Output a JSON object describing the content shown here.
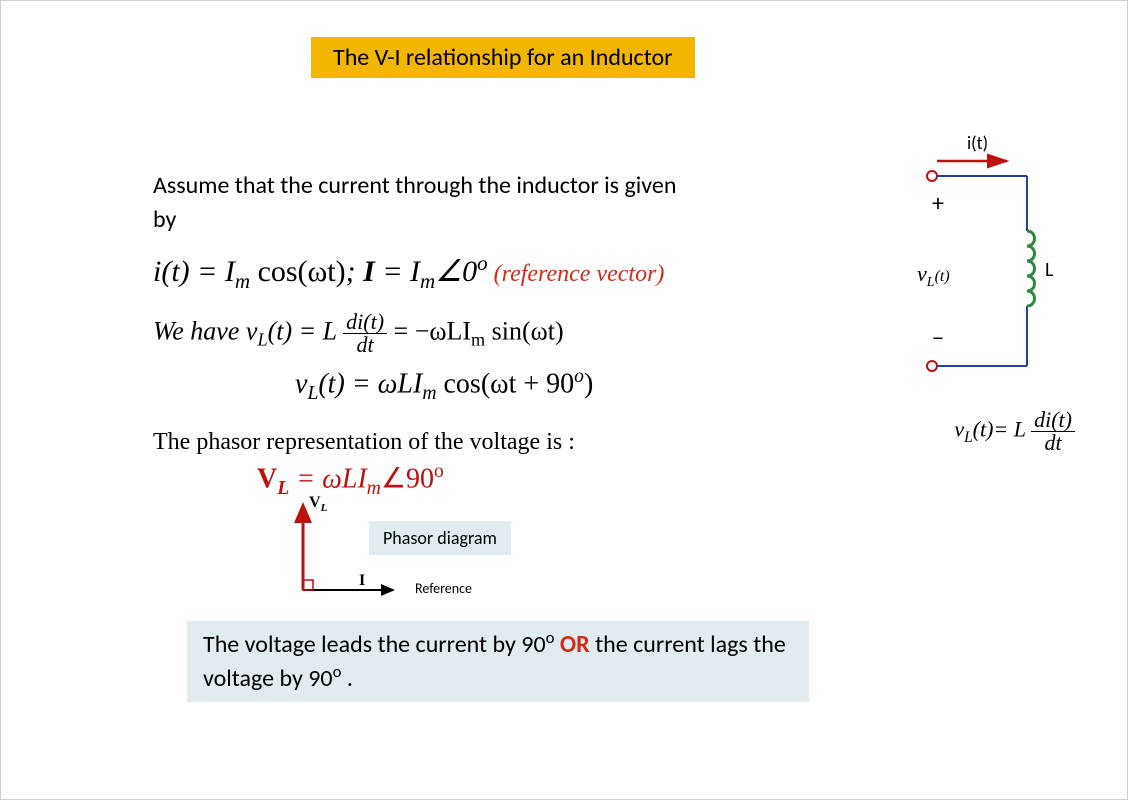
{
  "title": "The V-I relationship for an Inductor",
  "intro": {
    "line1": "Assume that the current through the inductor is given",
    "line2": "by"
  },
  "eq1": {
    "it": "i(t) = I",
    "m": "m",
    "coswt": " cos(ωt)",
    "semi": ";  ",
    "I": "I",
    "eq": " = I",
    "angle": "∠0",
    "deg": "o",
    "ref": " (reference vector)"
  },
  "eq2": {
    "lead": "We have  v",
    "L": "L",
    "t": "(t) = L",
    "frac_num": "di(t)",
    "frac_den": "dt",
    "rest": " = −ωLI",
    "m": "m",
    "sin": " sin(ωt)"
  },
  "eq3": {
    "v": "v",
    "L": "L",
    "t": "(t) = ωLI",
    "m": "m",
    "cos": " cos(ωt + 90",
    "deg": "o",
    "close": ")"
  },
  "phasor_intro": "The phasor representation of the voltage is :",
  "phasor_eq": {
    "V": "V",
    "L": "L",
    "eq": " = ωLI",
    "m": "m",
    "angle": "∠90",
    "deg": "o"
  },
  "phasor_diag_label": "Phasor diagram",
  "phasor_axes": {
    "vl": "V",
    "vl_sub": "L",
    "i": "I"
  },
  "reference_label": "Reference",
  "conclusion": {
    "a": "The voltage leads the current by 90",
    "deg": "o",
    "b": " ",
    "or": "OR",
    "c": " the current lags the voltage by 90",
    "d": " ."
  },
  "circuit": {
    "it": "i(t)",
    "plus": "+",
    "minus": "−",
    "vl": "v",
    "vl_sub": "L",
    "vl_t": "(t)",
    "L": "L"
  },
  "circuit_eq": {
    "v": "v",
    "L": "L",
    "t": "(t)= L ",
    "num": "di(t)",
    "den": "dt"
  }
}
